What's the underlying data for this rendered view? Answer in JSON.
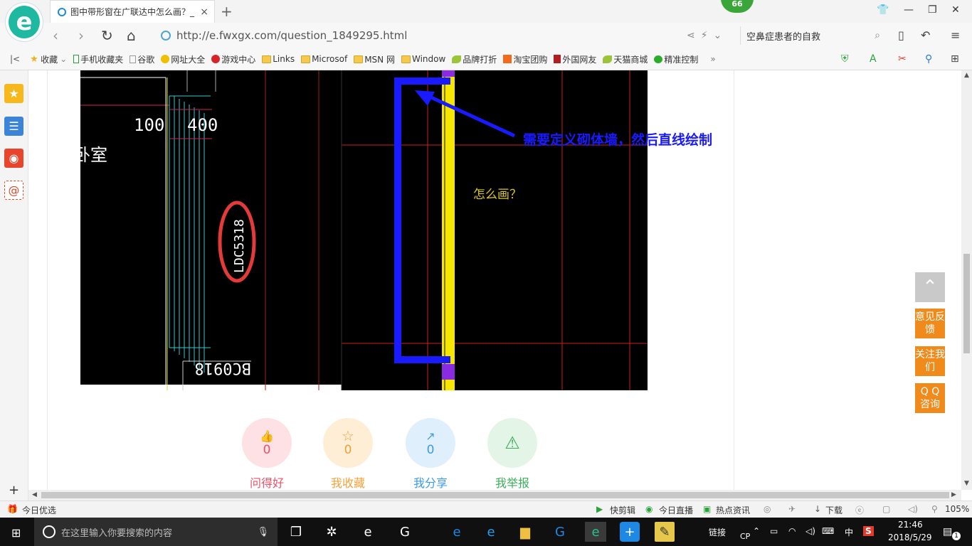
{
  "browser": {
    "tab_title": "图中带形窗在广联达中怎么画？_",
    "tab_close": "×",
    "new_tab": "+",
    "badge": "66",
    "url": "http://e.fwxgx.com/question_1849295.html",
    "search_text": "空鼻症患者的自救"
  },
  "bookmarks": [
    {
      "label": "收藏",
      "icon": "star-icon"
    },
    {
      "label": "手机收藏夹",
      "icon": "phone-icon"
    },
    {
      "label": "谷歌",
      "icon": "page-icon"
    },
    {
      "label": "网址大全",
      "icon": "web-icon"
    },
    {
      "label": "游戏中心",
      "icon": "game-icon"
    },
    {
      "label": "Links",
      "icon": "folder-icon"
    },
    {
      "label": "Microsof",
      "icon": "folder-icon"
    },
    {
      "label": "MSN 网",
      "icon": "folder-icon"
    },
    {
      "label": "Window",
      "icon": "folder-icon"
    },
    {
      "label": "品牌打折",
      "icon": "leaf-icon"
    },
    {
      "label": "淘宝团购",
      "icon": "taobao-icon"
    },
    {
      "label": "外国网友",
      "icon": "bookmark-icon"
    },
    {
      "label": "天猫商城",
      "icon": "leaf-icon"
    },
    {
      "label": "精准控制",
      "icon": "wechat-icon"
    }
  ],
  "bookmarks_more": "»",
  "cad": {
    "annot_text": "需要定义砌体墙，然后直线绘制",
    "question_text": "怎么画？",
    "dim_100": "100",
    "dim_400": "400",
    "room_text": "卧室",
    "window_code_1": "LDC5318",
    "window_code_2": "BC0918"
  },
  "reactions": [
    {
      "count": "0",
      "label": "问得好",
      "color": "#e8536b",
      "bg": "#fde1e4",
      "icon": "thumbs-up-icon",
      "glyph": "👍"
    },
    {
      "count": "0",
      "label": "我收藏",
      "color": "#f0a23a",
      "bg": "#fdeed5",
      "icon": "star-icon",
      "glyph": "☆"
    },
    {
      "count": "0",
      "label": "我分享",
      "color": "#3b9be8",
      "bg": "#dff0fc",
      "icon": "share-icon",
      "glyph": "↗"
    },
    {
      "count": "",
      "label": "我举报",
      "color": "#3caf5a",
      "bg": "#e2f5e6",
      "icon": "warning-icon",
      "glyph": "⚠"
    }
  ],
  "float_buttons": [
    {
      "label": "意见反馈"
    },
    {
      "label": "关注我们"
    },
    {
      "label": "Q Q 咨询"
    }
  ],
  "status": {
    "today": "今日优选",
    "kuaijianji": "快剪辑",
    "live": "今日直播",
    "news": "热点资讯",
    "download": "下载",
    "zoom": "105%"
  },
  "taskbar": {
    "search_placeholder": "在这里输入你要搜索的内容",
    "link": "链接",
    "ime": "中",
    "cp": "CP",
    "time": "21:46",
    "date": "2018/5/29",
    "notify_count": "1"
  }
}
